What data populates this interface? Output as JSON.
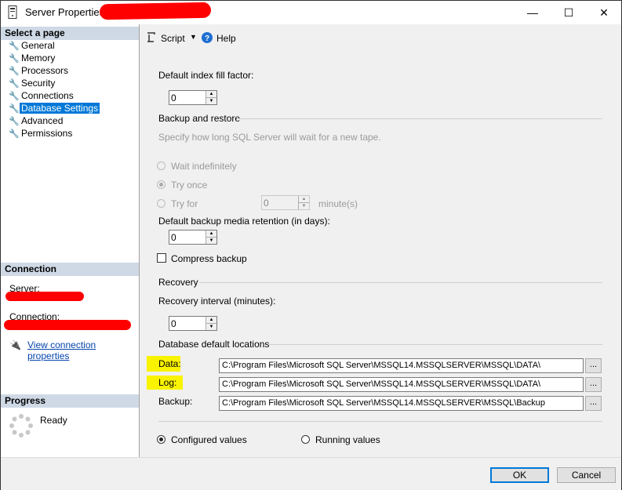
{
  "window": {
    "title": "Server Properties -",
    "minimize": "—",
    "maximize": "☐",
    "close": "✕"
  },
  "sidebar": {
    "select_header": "Select a page",
    "pages": [
      "General",
      "Memory",
      "Processors",
      "Security",
      "Connections",
      "Database Settings",
      "Advanced",
      "Permissions"
    ],
    "selected_page": "Database Settings",
    "connection_header": "Connection",
    "server_label": "Server:",
    "connection_label": "Connection:",
    "view_connection_link": "View connection properties",
    "progress_header": "Progress",
    "progress_status": "Ready"
  },
  "toolbar": {
    "script_label": "Script",
    "help_label": "Help"
  },
  "settings": {
    "fill_factor_label": "Default index fill factor:",
    "fill_factor_value": "0",
    "backup_group": "Backup and restore",
    "backup_desc": "Specify how long SQL Server will wait for a new tape.",
    "wait_indefinitely": "Wait indefinitely",
    "try_once": "Try once",
    "try_for": "Try for",
    "try_for_value": "0",
    "minutes_unit": "minute(s)",
    "retention_label": "Default backup media retention (in days):",
    "retention_value": "0",
    "compress_label": "Compress backup",
    "compress_checked": false,
    "recovery_group": "Recovery",
    "recovery_interval_label": "Recovery interval (minutes):",
    "recovery_interval_value": "0",
    "locations_group": "Database default locations",
    "data_label": "Data:",
    "data_path": "C:\\Program Files\\Microsoft SQL Server\\MSSQL14.MSSQLSERVER\\MSSQL\\DATA\\",
    "log_label": "Log:",
    "log_path": "C:\\Program Files\\Microsoft SQL Server\\MSSQL14.MSSQLSERVER\\MSSQL\\DATA\\",
    "backup_label": "Backup:",
    "backup_path": "C:\\Program Files\\Microsoft SQL Server\\MSSQL14.MSSQLSERVER\\MSSQL\\Backup",
    "browse_label": "...",
    "configured_values": "Configured values",
    "running_values": "Running values"
  },
  "footer": {
    "ok": "OK",
    "cancel": "Cancel"
  },
  "colors": {
    "selected": "#0078d7",
    "header_bg": "#cfd9e6",
    "highlight": "#f9f300",
    "redaction": "#ff0000"
  }
}
